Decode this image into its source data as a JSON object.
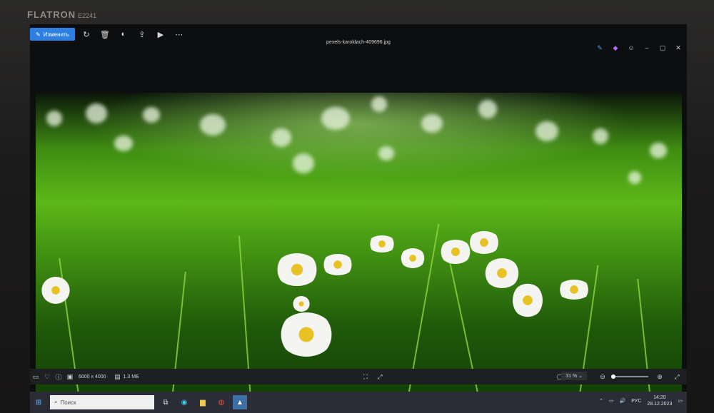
{
  "monitor": {
    "brand": "FLATRON",
    "model": "E2241"
  },
  "app": {
    "edit_button": "Изменить",
    "filename": "pexels-karoldach-409696.jpg",
    "toolbar_icons": [
      "rotate-icon",
      "trash-icon",
      "adjust-icon",
      "share-icon",
      "slideshow-icon",
      "more-icon"
    ]
  },
  "status": {
    "dimensions": "6000 x 4000",
    "size": "1.3 МБ",
    "zoom": "31 %"
  },
  "taskbar": {
    "search_placeholder": "Поиск",
    "language": "РУС",
    "time": "14:20",
    "date": "28.12.2023"
  }
}
